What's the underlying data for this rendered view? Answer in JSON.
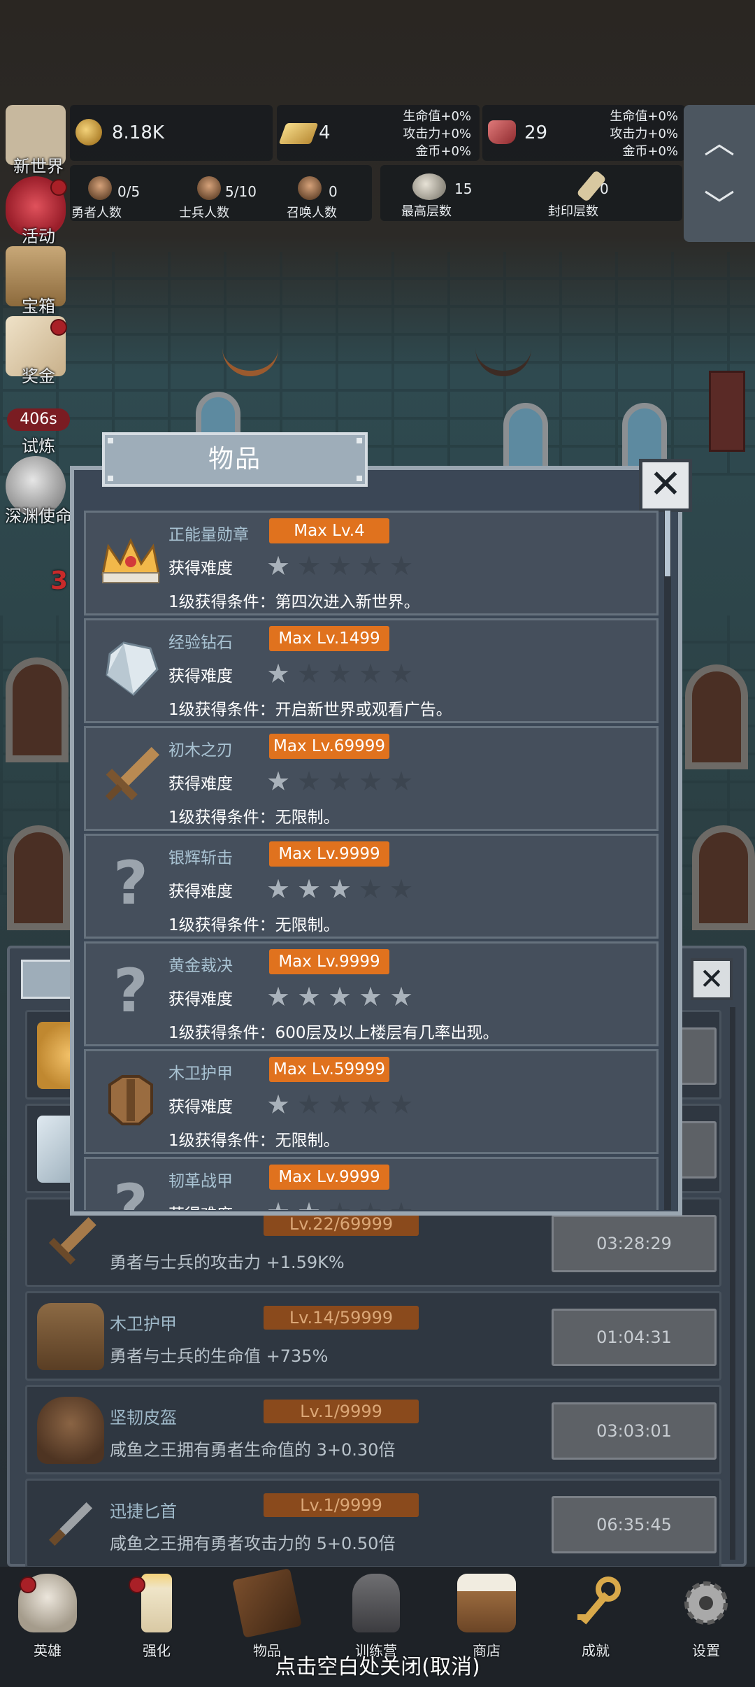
{
  "resources": {
    "gold": "8.18K",
    "ingot": "4",
    "ingot_bonus": [
      "生命值+0%",
      "攻击力+0%",
      "金币+0%"
    ],
    "meat": "29",
    "meat_bonus": [
      "生命值+0%",
      "攻击力+0%",
      "金币+0%"
    ]
  },
  "counts": [
    {
      "value": "0/5",
      "label": "勇者人数"
    },
    {
      "value": "5/10",
      "label": "士兵人数"
    },
    {
      "value": "0",
      "label": "召唤人数"
    }
  ],
  "floors": [
    {
      "value": "15",
      "label": "最高层数"
    },
    {
      "value": "0",
      "label": "封印层数"
    }
  ],
  "left_menu": [
    {
      "label": "新世界",
      "icon": "map-icon"
    },
    {
      "label": "活动",
      "icon": "heart-icon"
    },
    {
      "label": "宝箱",
      "icon": "chest-icon"
    },
    {
      "label": "奖金",
      "icon": "envelope-icon"
    },
    {
      "label": "试炼",
      "icon": "trial-icon",
      "timer": "406s"
    },
    {
      "label": "深渊使命",
      "icon": "orb-icon"
    }
  ],
  "left_red_number": "3",
  "modal": {
    "title": "物品",
    "difficulty_label": "获得难度",
    "items": [
      {
        "name": "正能量勋章",
        "max_level": "Max Lv.4",
        "stars": 1,
        "condition": "1级获得条件：第四次进入新世界。",
        "icon": "crown-icon"
      },
      {
        "name": "经验钻石",
        "max_level": "Max Lv.1499",
        "stars": 1,
        "condition": "1级获得条件：开启新世界或观看广告。",
        "icon": "diamond-icon"
      },
      {
        "name": "初木之刃",
        "max_level": "Max Lv.69999",
        "stars": 1,
        "condition": "1级获得条件：无限制。",
        "icon": "wooden-sword-icon"
      },
      {
        "name": "银辉斩击",
        "max_level": "Max Lv.9999",
        "stars": 3,
        "condition": "1级获得条件：无限制。",
        "icon": "question-mark-icon"
      },
      {
        "name": "黄金裁决",
        "max_level": "Max Lv.9999",
        "stars": 5,
        "condition": "1级获得条件：600层及以上楼层有几率出现。",
        "icon": "question-mark-icon"
      },
      {
        "name": "木卫护甲",
        "max_level": "Max Lv.59999",
        "stars": 1,
        "condition": "1级获得条件：无限制。",
        "icon": "wooden-armor-icon"
      },
      {
        "name": "韧革战甲",
        "max_level": "Max Lv.9999",
        "stars": 2,
        "condition": "",
        "icon": "question-mark-icon"
      }
    ]
  },
  "background_list": [
    {
      "name": "",
      "level": "Lv.22/69999",
      "desc": "勇者与士兵的攻击力 +1.59K%",
      "timer": "03:28:29",
      "icon": "wooden-sword-icon"
    },
    {
      "name": "木卫护甲",
      "level": "Lv.14/59999",
      "desc": "勇者与士兵的生命值 +735%",
      "timer": "01:04:31",
      "icon": "wooden-armor-icon"
    },
    {
      "name": "坚韧皮盔",
      "level": "Lv.1/9999",
      "desc": "咸鱼之王拥有勇者生命值的 3+0.30倍",
      "timer": "03:03:01",
      "icon": "leather-helmet-icon"
    },
    {
      "name": "迅捷匕首",
      "level": "Lv.1/9999",
      "desc": "咸鱼之王拥有勇者攻击力的 5+0.50倍",
      "timer": "06:35:45",
      "icon": "dagger-icon"
    }
  ],
  "bottom_nav": [
    {
      "label": "英雄",
      "icon": "skull-icon",
      "badge": true
    },
    {
      "label": "强化",
      "icon": "candle-icon",
      "badge": true
    },
    {
      "label": "物品",
      "icon": "book-icon",
      "badge": false
    },
    {
      "label": "训练营",
      "icon": "lantern-icon",
      "badge": false
    },
    {
      "label": "商店",
      "icon": "beer-mug-icon",
      "badge": false
    },
    {
      "label": "成就",
      "icon": "key-icon",
      "badge": false
    },
    {
      "label": "设置",
      "icon": "gear-icon",
      "badge": false
    }
  ],
  "close_hint": "点击空白处关闭(取消)",
  "colors": {
    "level_badge": "#e0721e",
    "item_name": "#a9c3d3",
    "panel_bg": "#3b4756",
    "row_bg": "#454f5c"
  }
}
